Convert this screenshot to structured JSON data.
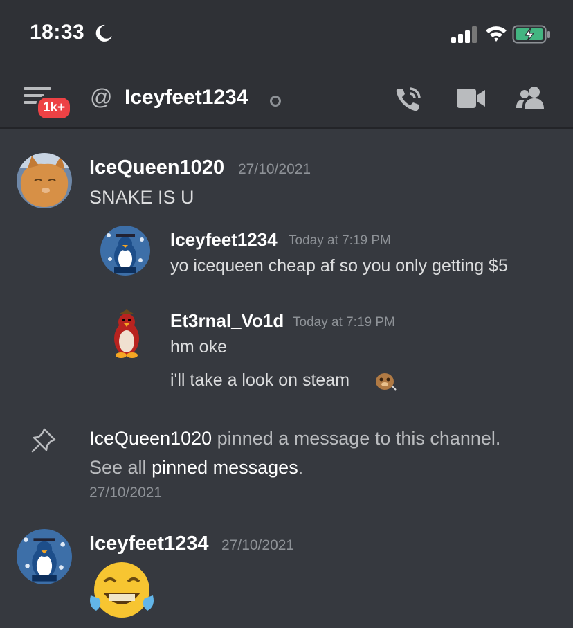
{
  "status_bar": {
    "time": "18:33"
  },
  "header": {
    "badge": "1k+",
    "at_symbol": "@",
    "channel_name": "Iceyfeet1234"
  },
  "messages": [
    {
      "username": "IceQueen1020",
      "timestamp": "27/10/2021",
      "lines": [
        "SNAKE IS U"
      ]
    },
    {
      "username": "Iceyfeet1234",
      "timestamp": "Today at 7:19 PM",
      "lines": [
        "yo icequeen cheap af so you only getting $5"
      ]
    },
    {
      "username": "Et3rnal_Vo1d",
      "timestamp": "Today at 7:19 PM",
      "lines": [
        "hm oke",
        "i'll take a look on steam"
      ]
    },
    {
      "username": "Iceyfeet1234",
      "timestamp": "27/10/2021",
      "lines": []
    }
  ],
  "system_message": {
    "actor": "IceQueen1020",
    "action": " pinned a message to this channel.",
    "see_all": "See all ",
    "link": "pinned messages",
    "period": ".",
    "timestamp": "27/10/2021"
  },
  "colors": {
    "background": "#36393f",
    "header": "#2f3136",
    "badge": "#ed4245",
    "battery": "#43b581"
  }
}
